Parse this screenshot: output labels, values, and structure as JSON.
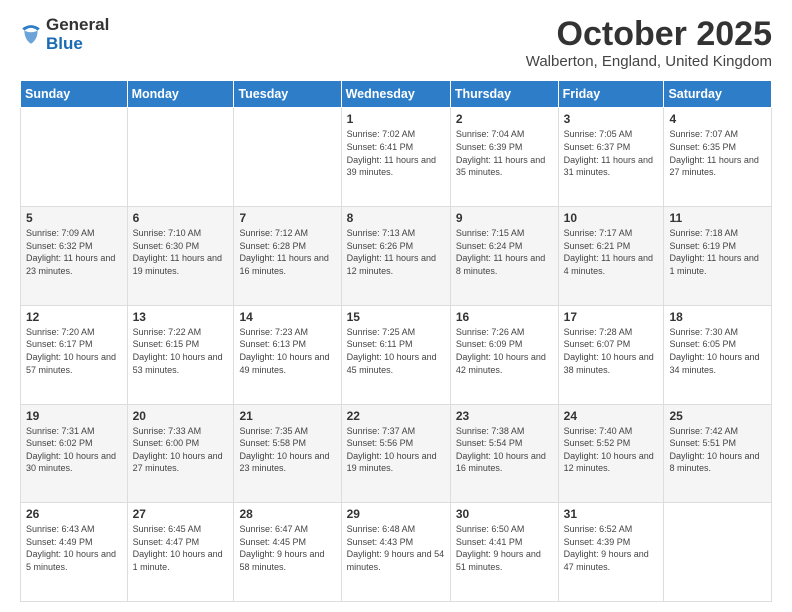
{
  "logo": {
    "general": "General",
    "blue": "Blue"
  },
  "title": "October 2025",
  "location": "Walberton, England, United Kingdom",
  "days_of_week": [
    "Sunday",
    "Monday",
    "Tuesday",
    "Wednesday",
    "Thursday",
    "Friday",
    "Saturday"
  ],
  "weeks": [
    [
      {
        "day": "",
        "info": ""
      },
      {
        "day": "",
        "info": ""
      },
      {
        "day": "",
        "info": ""
      },
      {
        "day": "1",
        "info": "Sunrise: 7:02 AM\nSunset: 6:41 PM\nDaylight: 11 hours and 39 minutes."
      },
      {
        "day": "2",
        "info": "Sunrise: 7:04 AM\nSunset: 6:39 PM\nDaylight: 11 hours and 35 minutes."
      },
      {
        "day": "3",
        "info": "Sunrise: 7:05 AM\nSunset: 6:37 PM\nDaylight: 11 hours and 31 minutes."
      },
      {
        "day": "4",
        "info": "Sunrise: 7:07 AM\nSunset: 6:35 PM\nDaylight: 11 hours and 27 minutes."
      }
    ],
    [
      {
        "day": "5",
        "info": "Sunrise: 7:09 AM\nSunset: 6:32 PM\nDaylight: 11 hours and 23 minutes."
      },
      {
        "day": "6",
        "info": "Sunrise: 7:10 AM\nSunset: 6:30 PM\nDaylight: 11 hours and 19 minutes."
      },
      {
        "day": "7",
        "info": "Sunrise: 7:12 AM\nSunset: 6:28 PM\nDaylight: 11 hours and 16 minutes."
      },
      {
        "day": "8",
        "info": "Sunrise: 7:13 AM\nSunset: 6:26 PM\nDaylight: 11 hours and 12 minutes."
      },
      {
        "day": "9",
        "info": "Sunrise: 7:15 AM\nSunset: 6:24 PM\nDaylight: 11 hours and 8 minutes."
      },
      {
        "day": "10",
        "info": "Sunrise: 7:17 AM\nSunset: 6:21 PM\nDaylight: 11 hours and 4 minutes."
      },
      {
        "day": "11",
        "info": "Sunrise: 7:18 AM\nSunset: 6:19 PM\nDaylight: 11 hours and 1 minute."
      }
    ],
    [
      {
        "day": "12",
        "info": "Sunrise: 7:20 AM\nSunset: 6:17 PM\nDaylight: 10 hours and 57 minutes."
      },
      {
        "day": "13",
        "info": "Sunrise: 7:22 AM\nSunset: 6:15 PM\nDaylight: 10 hours and 53 minutes."
      },
      {
        "day": "14",
        "info": "Sunrise: 7:23 AM\nSunset: 6:13 PM\nDaylight: 10 hours and 49 minutes."
      },
      {
        "day": "15",
        "info": "Sunrise: 7:25 AM\nSunset: 6:11 PM\nDaylight: 10 hours and 45 minutes."
      },
      {
        "day": "16",
        "info": "Sunrise: 7:26 AM\nSunset: 6:09 PM\nDaylight: 10 hours and 42 minutes."
      },
      {
        "day": "17",
        "info": "Sunrise: 7:28 AM\nSunset: 6:07 PM\nDaylight: 10 hours and 38 minutes."
      },
      {
        "day": "18",
        "info": "Sunrise: 7:30 AM\nSunset: 6:05 PM\nDaylight: 10 hours and 34 minutes."
      }
    ],
    [
      {
        "day": "19",
        "info": "Sunrise: 7:31 AM\nSunset: 6:02 PM\nDaylight: 10 hours and 30 minutes."
      },
      {
        "day": "20",
        "info": "Sunrise: 7:33 AM\nSunset: 6:00 PM\nDaylight: 10 hours and 27 minutes."
      },
      {
        "day": "21",
        "info": "Sunrise: 7:35 AM\nSunset: 5:58 PM\nDaylight: 10 hours and 23 minutes."
      },
      {
        "day": "22",
        "info": "Sunrise: 7:37 AM\nSunset: 5:56 PM\nDaylight: 10 hours and 19 minutes."
      },
      {
        "day": "23",
        "info": "Sunrise: 7:38 AM\nSunset: 5:54 PM\nDaylight: 10 hours and 16 minutes."
      },
      {
        "day": "24",
        "info": "Sunrise: 7:40 AM\nSunset: 5:52 PM\nDaylight: 10 hours and 12 minutes."
      },
      {
        "day": "25",
        "info": "Sunrise: 7:42 AM\nSunset: 5:51 PM\nDaylight: 10 hours and 8 minutes."
      }
    ],
    [
      {
        "day": "26",
        "info": "Sunrise: 6:43 AM\nSunset: 4:49 PM\nDaylight: 10 hours and 5 minutes."
      },
      {
        "day": "27",
        "info": "Sunrise: 6:45 AM\nSunset: 4:47 PM\nDaylight: 10 hours and 1 minute."
      },
      {
        "day": "28",
        "info": "Sunrise: 6:47 AM\nSunset: 4:45 PM\nDaylight: 9 hours and 58 minutes."
      },
      {
        "day": "29",
        "info": "Sunrise: 6:48 AM\nSunset: 4:43 PM\nDaylight: 9 hours and 54 minutes."
      },
      {
        "day": "30",
        "info": "Sunrise: 6:50 AM\nSunset: 4:41 PM\nDaylight: 9 hours and 51 minutes."
      },
      {
        "day": "31",
        "info": "Sunrise: 6:52 AM\nSunset: 4:39 PM\nDaylight: 9 hours and 47 minutes."
      },
      {
        "day": "",
        "info": ""
      }
    ]
  ]
}
